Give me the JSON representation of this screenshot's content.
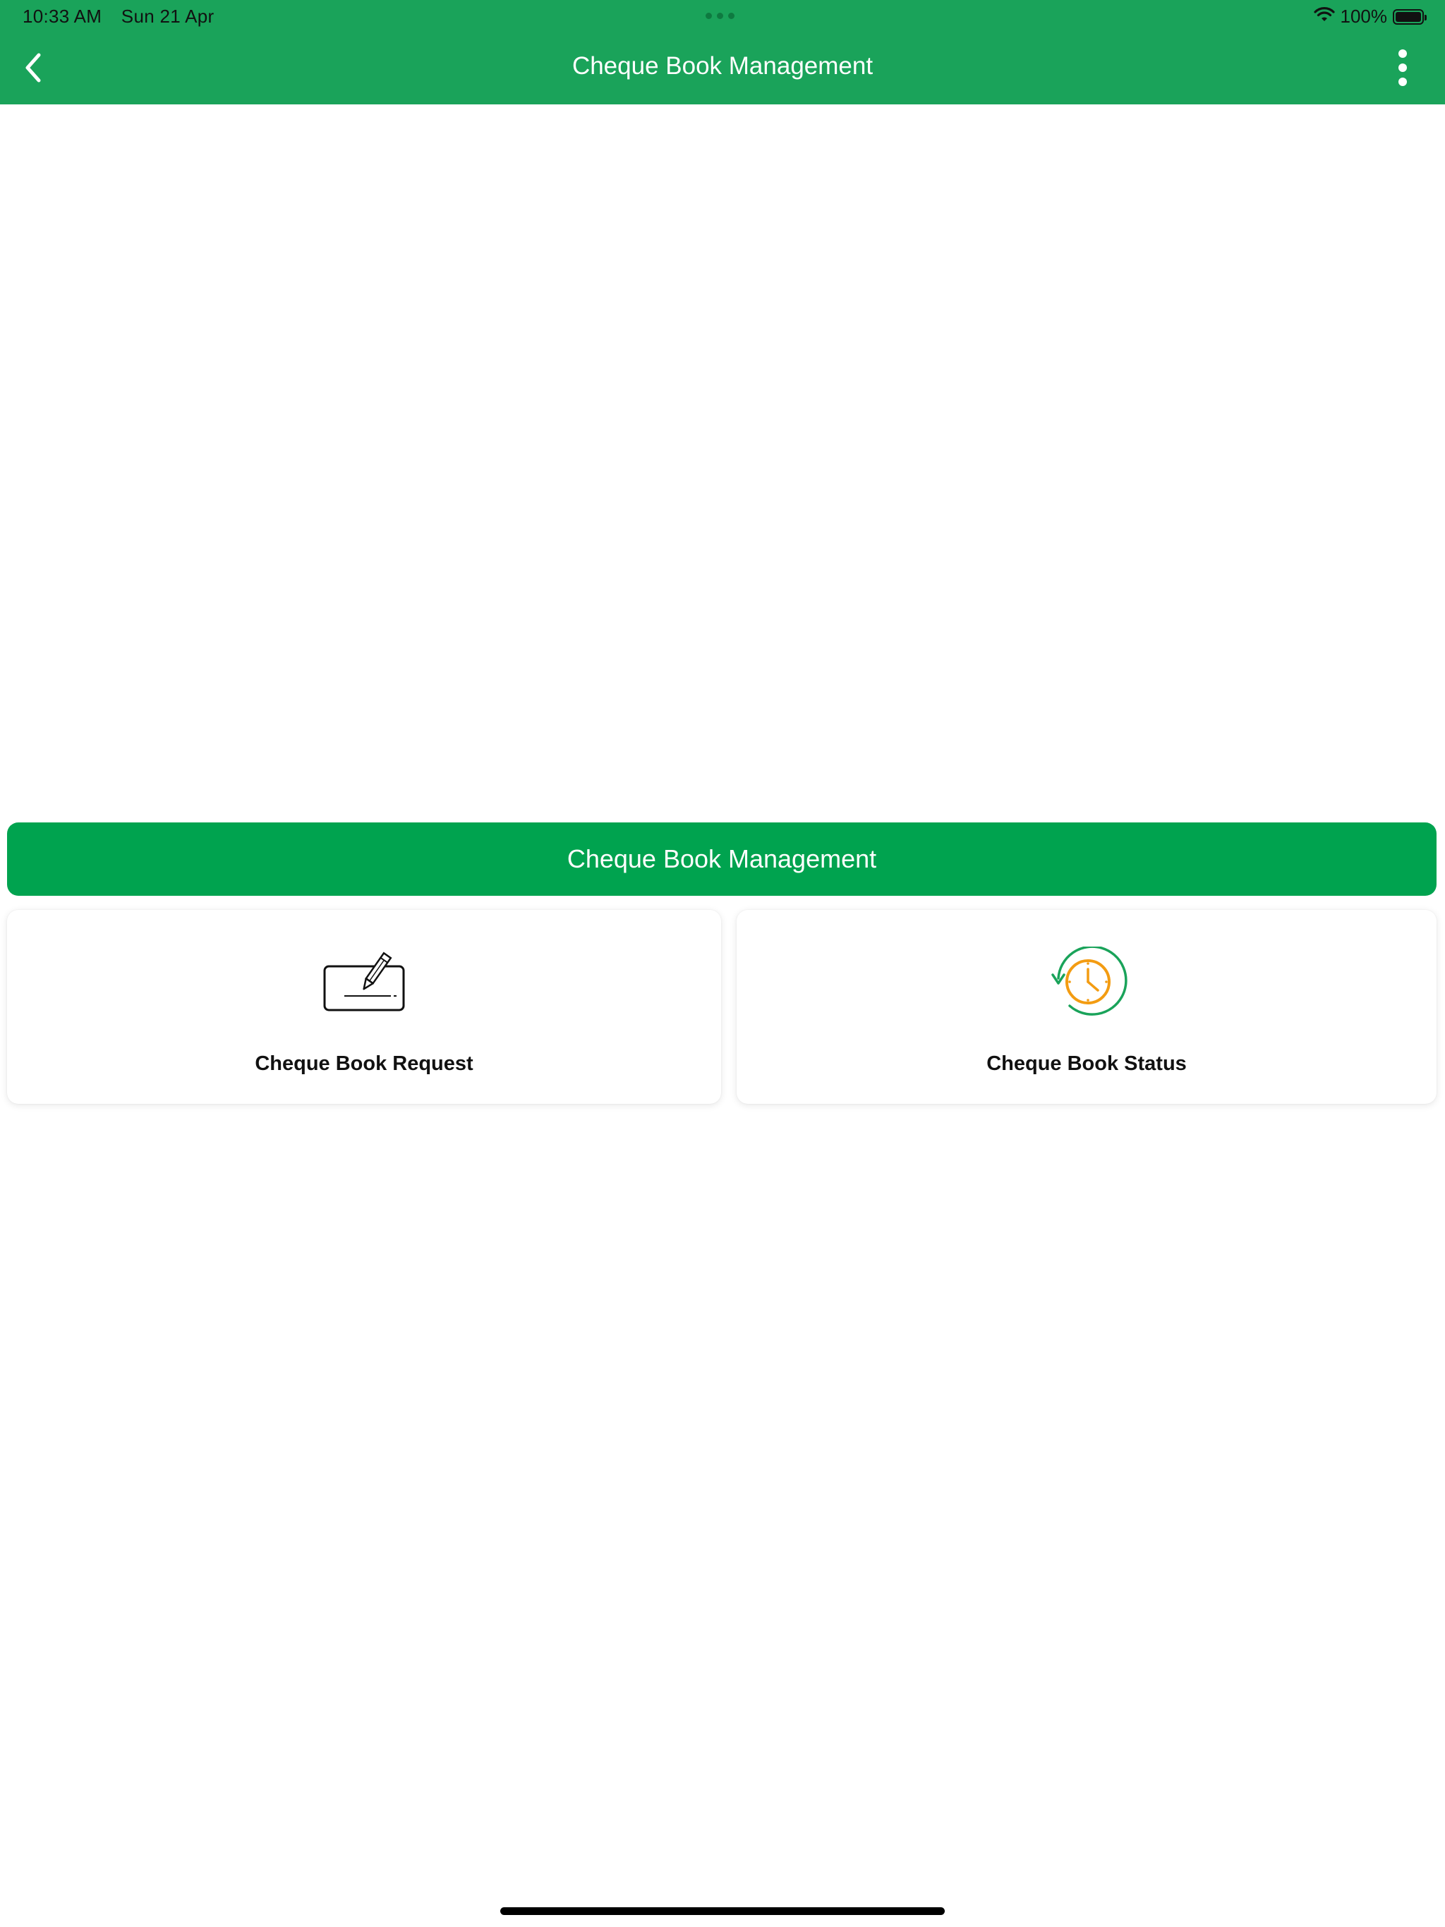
{
  "status_bar": {
    "time": "10:33 AM",
    "date": "Sun 21 Apr",
    "battery": "100%"
  },
  "nav": {
    "title": "Cheque Book Management",
    "back_icon": "chevron-left-icon",
    "menu_icon": "more-vertical-icon"
  },
  "section": {
    "title": "Cheque Book Management"
  },
  "cards": [
    {
      "label": "Cheque Book Request",
      "icon": "cheque-sign-icon"
    },
    {
      "label": "Cheque Book Status",
      "icon": "clock-history-icon"
    }
  ],
  "colors": {
    "header_green": "#1aa35a",
    "section_green": "#00a34f",
    "clock_orange": "#f39c12"
  }
}
